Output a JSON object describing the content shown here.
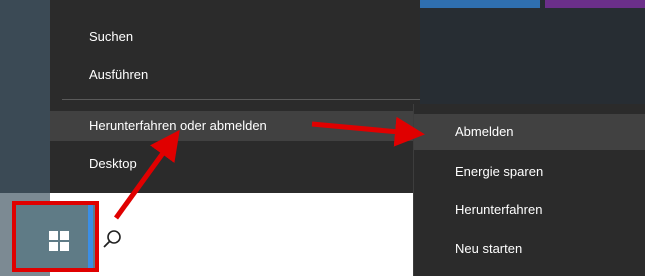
{
  "context_menu": {
    "items": [
      {
        "label": "Suchen"
      },
      {
        "label": "Ausführen"
      },
      {
        "label": "Herunterfahren oder abmelden",
        "submenu_indicator": "›"
      },
      {
        "label": "Desktop"
      }
    ]
  },
  "submenu": {
    "items": [
      {
        "label": "Abmelden"
      },
      {
        "label": "Energie sparen"
      },
      {
        "label": "Herunterfahren"
      },
      {
        "label": "Neu starten"
      }
    ]
  },
  "taskbar": {
    "start_icon": "windows-logo-icon",
    "search_icon": "search-icon"
  },
  "annotation": {
    "highlight_color": "#e00000"
  }
}
